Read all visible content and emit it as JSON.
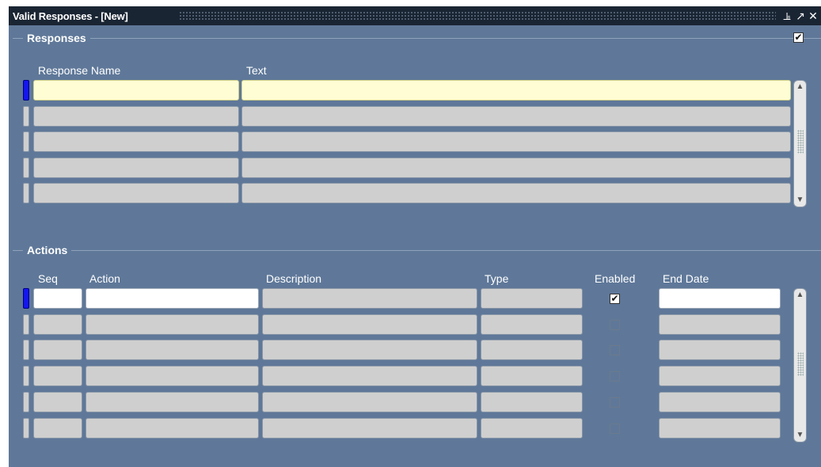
{
  "window": {
    "title": "Valid Responses - [New]",
    "controls": [
      "minimize-icon",
      "maximize-icon",
      "close-icon"
    ]
  },
  "responses": {
    "section_title": "Responses",
    "header_checkbox_checked": true,
    "columns": {
      "response_name": "Response Name",
      "text": "Text"
    },
    "rows": [
      {
        "response_name": "",
        "text": "",
        "current": true
      },
      {
        "response_name": "",
        "text": "",
        "current": false
      },
      {
        "response_name": "",
        "text": "",
        "current": false
      },
      {
        "response_name": "",
        "text": "",
        "current": false
      },
      {
        "response_name": "",
        "text": "",
        "current": false
      }
    ]
  },
  "actions": {
    "section_title": "Actions",
    "columns": {
      "seq": "Seq",
      "action": "Action",
      "description": "Description",
      "type": "Type",
      "enabled": "Enabled",
      "end_date": "End Date"
    },
    "rows": [
      {
        "seq": "",
        "action": "",
        "description": "",
        "type": "",
        "enabled": true,
        "end_date": "",
        "current": true
      },
      {
        "seq": "",
        "action": "",
        "description": "",
        "type": "",
        "enabled": false,
        "end_date": "",
        "current": false
      },
      {
        "seq": "",
        "action": "",
        "description": "",
        "type": "",
        "enabled": false,
        "end_date": "",
        "current": false
      },
      {
        "seq": "",
        "action": "",
        "description": "",
        "type": "",
        "enabled": false,
        "end_date": "",
        "current": false
      },
      {
        "seq": "",
        "action": "",
        "description": "",
        "type": "",
        "enabled": false,
        "end_date": "",
        "current": false
      },
      {
        "seq": "",
        "action": "",
        "description": "",
        "type": "",
        "enabled": false,
        "end_date": "",
        "current": false
      }
    ]
  },
  "colors": {
    "canvas": "#5f7899",
    "titlebar": "#1a2533",
    "current_record_field": "#fffdd4",
    "inactive_field": "#cfcfcf",
    "row_indicator_current": "#1515ee"
  }
}
